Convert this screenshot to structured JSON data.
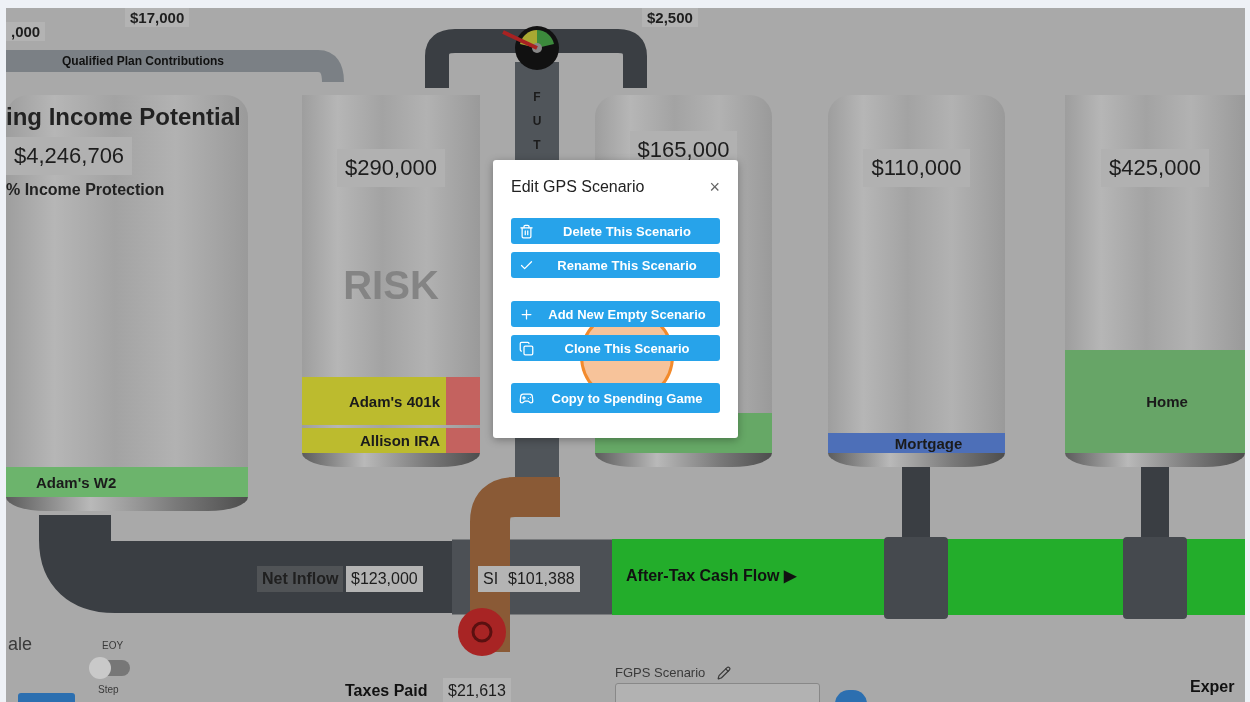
{
  "top_amounts": [
    ",000",
    "$17,000",
    "$2,500"
  ],
  "contributions_pipe": {
    "label": "Qualified Plan Contributions"
  },
  "future_pipe": {
    "letters": [
      "F",
      "U",
      "T"
    ]
  },
  "tanks": [
    {
      "title": "ing Income Potential",
      "value": "$4,246,706",
      "subtitle": "% Income Protection",
      "bands": [
        {
          "label": "Adam's W2",
          "color": "#6cb46c"
        }
      ]
    },
    {
      "value": "$290,000",
      "watermark": "RISK",
      "bands": [
        {
          "label": "Adam's 401k",
          "color": "#bcbb2e"
        },
        {
          "label": "Allison IRA",
          "color": "#bcbb2e"
        }
      ],
      "side_blocks": [
        {
          "color": "#c4625f"
        },
        {
          "color": "#c4625f"
        }
      ]
    },
    {
      "value": "$165,000",
      "bands": [
        {
          "color": "#66a866"
        }
      ]
    },
    {
      "value": "$110,000",
      "bands": [
        {
          "label": "Mortgage",
          "color": "#4d6fb8"
        }
      ]
    },
    {
      "value": "$425,000",
      "bands": [
        {
          "label": "Home",
          "color": "#67a567"
        }
      ]
    }
  ],
  "flows": {
    "net_inflow_label": "Net Inflow",
    "net_inflow_value": "$123,000",
    "si_label": "SI",
    "si_value": "$101,388",
    "cash_flow_label": "After-Tax Cash Flow ▶"
  },
  "controls": {
    "scale_label": "ale",
    "toggle_label": "EOY",
    "toggle_on": false,
    "toggle_caption": "Step",
    "taxes_label": "Taxes Paid",
    "taxes_value": "$21,613",
    "scenario_label": "FGPS Scenario",
    "expenses_label": "Exper"
  },
  "dialog": {
    "title": "Edit GPS Scenario",
    "close": "×",
    "actions": [
      {
        "label": "Delete This Scenario",
        "kind": "delete"
      },
      {
        "label": "Rename This Scenario",
        "kind": "rename"
      },
      {
        "label": "Add New Empty Scenario",
        "kind": "add"
      },
      {
        "label": "Clone This Scenario",
        "kind": "clone"
      },
      {
        "label": "Copy to Spending Game",
        "kind": "game"
      }
    ]
  }
}
